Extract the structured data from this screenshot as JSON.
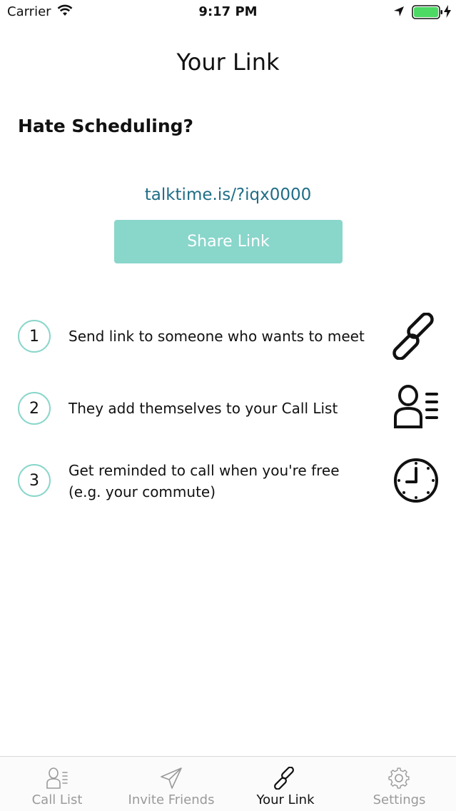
{
  "status_bar": {
    "carrier": "Carrier",
    "time": "9:17 PM",
    "battery_color": "#4cd964"
  },
  "header": {
    "title": "Your Link"
  },
  "main": {
    "heading": "Hate Scheduling?",
    "link_url": "talktime.is/?iqx0000",
    "share_button_label": "Share Link",
    "accent_color": "#89d6cb",
    "link_color": "#1f6d86",
    "steps": [
      {
        "number": "1",
        "text_line1": "Send link to someone who wants to meet",
        "text_line2": "",
        "icon": "link-icon"
      },
      {
        "number": "2",
        "text_line1": "They add themselves to your Call List",
        "text_line2": "",
        "icon": "call-list-icon"
      },
      {
        "number": "3",
        "text_line1": "Get reminded to call when you're free",
        "text_line2": "(e.g. your commute)",
        "icon": "clock-icon"
      }
    ]
  },
  "tab_bar": {
    "tabs": [
      {
        "label": "Call List",
        "icon": "call-list-icon",
        "active": false
      },
      {
        "label": "Invite Friends",
        "icon": "paper-plane-icon",
        "active": false
      },
      {
        "label": "Your Link",
        "icon": "link-icon",
        "active": true
      },
      {
        "label": "Settings",
        "icon": "gear-icon",
        "active": false
      }
    ]
  }
}
